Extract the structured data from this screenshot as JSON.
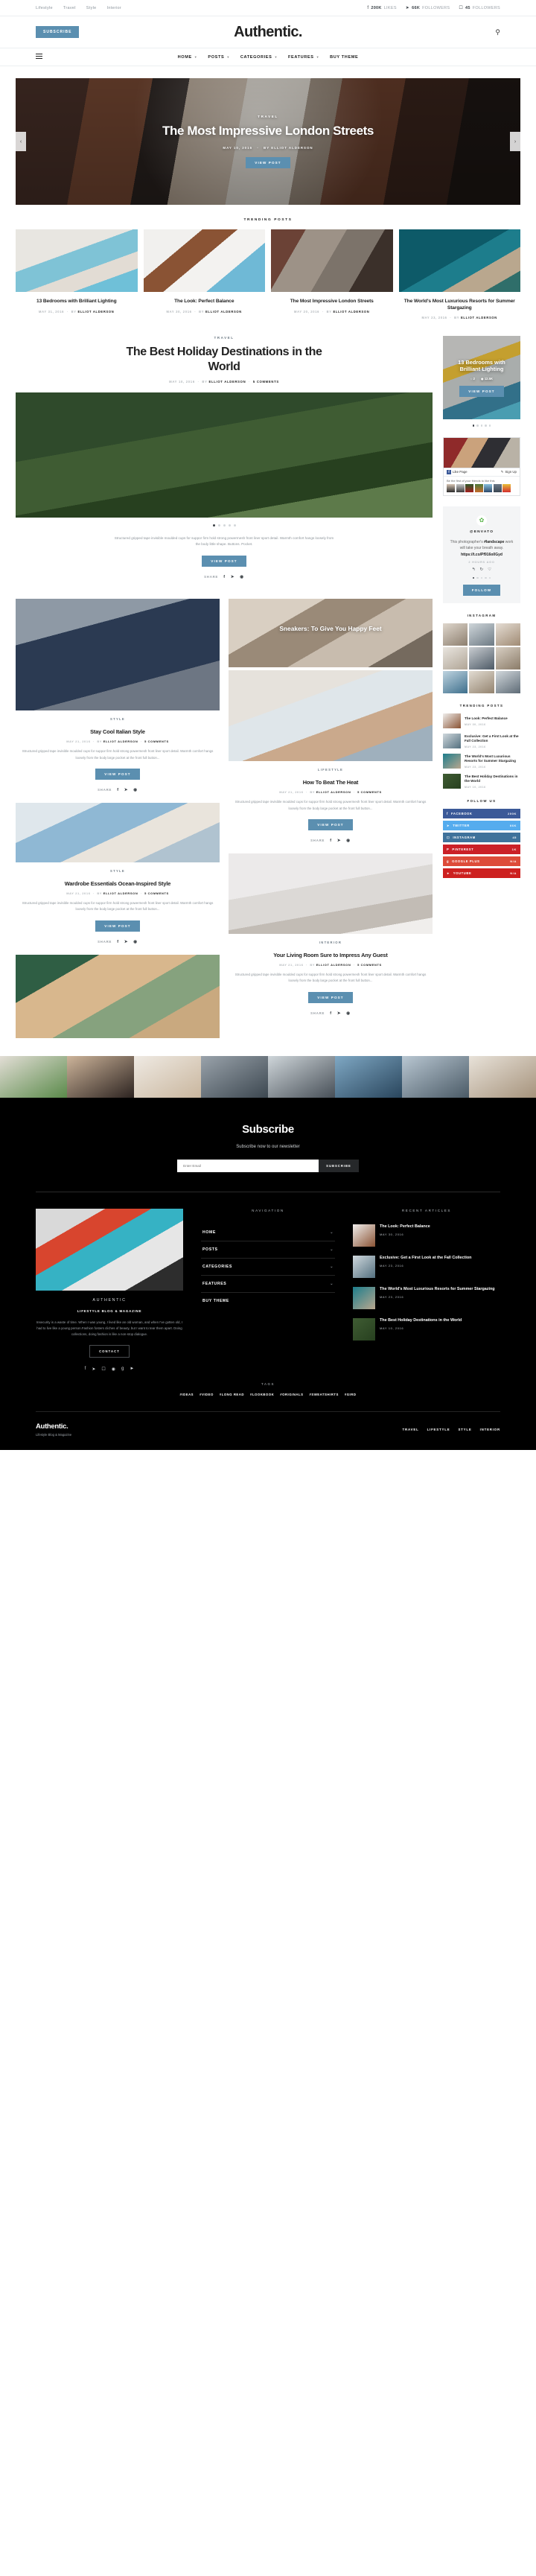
{
  "topbar": {
    "links": [
      "Lifestyle",
      "Travel",
      "Style",
      "Interior"
    ],
    "social": [
      {
        "icon": "facebook-icon",
        "glyph": "f",
        "count": "200K",
        "label": "LIKES"
      },
      {
        "icon": "twitter-icon",
        "glyph": "ᵛ",
        "count": "66K",
        "label": "FOLLOWERS"
      },
      {
        "icon": "instagram-icon",
        "glyph": "▢",
        "count": "45",
        "label": "FOLLOWERS"
      }
    ]
  },
  "masthead": {
    "subscribe_label": "SUBSCRIBE",
    "logo": "Authentic.",
    "search_icon": "search-icon"
  },
  "nav": {
    "items": [
      {
        "label": "HOME",
        "caret": true
      },
      {
        "label": "POSTS",
        "caret": true
      },
      {
        "label": "CATEGORIES",
        "caret": true
      },
      {
        "label": "FEATURES",
        "caret": true
      },
      {
        "label": "BUY THEME",
        "caret": false
      }
    ]
  },
  "hero": {
    "category": "TRAVEL",
    "title": "The Most Impressive London Streets",
    "date": "MAY 10, 2016",
    "by": "BY ELLIOT ALDERSON",
    "button": "VIEW POST"
  },
  "trending": {
    "section_label": "TRENDING POSTS",
    "cards": [
      {
        "title": "13 Bedrooms with Brilliant Lighting",
        "date": "MAY 31, 2016",
        "by": "BY",
        "author": "ELLIOT ALDERSON",
        "thumb": "th1"
      },
      {
        "title": "The Look: Perfect Balance",
        "date": "MAY 30, 2016",
        "by": "BY",
        "author": "ELLIOT ALDERSON",
        "thumb": "th2"
      },
      {
        "title": "The Most Impressive London Streets",
        "date": "MAY 20, 2016",
        "by": "BY",
        "author": "ELLIOT ALDERSON",
        "thumb": "th3"
      },
      {
        "title": "The World's Most Luxurious Resorts for Summer Stargazing",
        "date": "MAY 23, 2016",
        "by": "BY",
        "author": "ELLIOT ALDERSON",
        "thumb": "th4"
      }
    ]
  },
  "featured": {
    "category": "TRAVEL",
    "title": "The Best Holiday Destinations in the World",
    "date": "MAY 10, 2016",
    "by": "BY",
    "author": "ELLIOT ALDERSON",
    "comments": "5 COMMENTS",
    "excerpt": "Structured gripped tape invisible moulded cups for suppor firm hold strong powermesh front liner sport detail. Warmth comfort hangs loosely from the body little shape. Buttons. Pocket.",
    "button": "VIEW POST",
    "share_label": "SHARE"
  },
  "posts": [
    {
      "image": "img-a",
      "category": "STYLE",
      "title": "Stay Cool Italian Style",
      "date": "MAY 21, 2016",
      "by": "BY",
      "author": "ELLIOT ALDERSON",
      "comments": "5 COMMENTS",
      "excerpt": "Structured gripped tape invisible moulded cups for suppor firm hold strong powermesh front liner sport detail. Warmth comfort hangs loosely from the body large pocket at the front full button...",
      "button": "VIEW POST",
      "share_label": "SHARE"
    },
    {
      "image": "img-b",
      "overlay": "Sneakers: To Give You Happy Feet",
      "category": "LIFESTYLE",
      "title": "How To Beat The Heat",
      "date": "MAY 21, 2016",
      "by": "BY",
      "author": "ELLIOT ALDERSON",
      "comments": "5 COMMENTS",
      "excerpt": "Structured gripped tape invisible moulded cups for suppor firm hold strong powermesh front liner sport detail. Warmth comfort hangs loosely from the body large pocket at the front full button...",
      "button": "VIEW POST",
      "share_label": "SHARE"
    },
    {
      "image": "img-d",
      "category": "STYLE",
      "title": "Wardrobe Essentials Ocean-Inspired Style",
      "date": "MAY 21, 2016",
      "by": "BY",
      "author": "ELLIOT ALDERSON",
      "comments": "5 COMMENTS",
      "excerpt": "Structured gripped tape invisible moulded cups for suppor firm hold strong powermesh front liner sport detail. Warmth comfort hangs loosely from the body large pocket at the front full button...",
      "button": "VIEW POST",
      "share_label": "SHARE"
    },
    {
      "image": "img-e",
      "category": "INTERIOR",
      "title": "Your Living Room Sure to Impress Any Guest",
      "date": "MAY 21, 2016",
      "by": "BY",
      "author": "ELLIOT ALDERSON",
      "comments": "5 COMMENTS",
      "excerpt": "Structured gripped tape invisible moulded cups for suppor firm hold strong powermesh front liner sport detail. Warmth comfort hangs loosely from the body large pocket at the front full button...",
      "button": "VIEW POST",
      "share_label": "SHARE"
    }
  ],
  "sidebar": {
    "featured": {
      "title": "13 Bedrooms with Brilliant Lighting",
      "comments": "2",
      "views": "12.5K",
      "button": "VIEW POST"
    },
    "facebook": {
      "like_label": "Like Page",
      "signup_label": "Sign Up",
      "friends_text": "Be the first of your friends to like this"
    },
    "twitter": {
      "handle": "@ENVATO",
      "text_1": "This photographer's ",
      "hashtag": "#landscape",
      "text_2": " work will take your breath away.",
      "link": "https://t.co/Pf916o0Gyd",
      "ago": "2 HOURS AGO",
      "follow": "FOLLOW"
    },
    "instagram_head": "INSTAGRAM",
    "trending_head": "TRENDING POSTS",
    "trending_items": [
      {
        "title": "The Look: Perfect Balance",
        "date": "MAY 30, 2016"
      },
      {
        "title": "Exclusive: Get a First Look at the Fall Collection",
        "date": "MAY 23, 2016"
      },
      {
        "title": "The World's Most Luxurious Resorts for Summer Stargazing",
        "date": "MAY 23, 2016"
      },
      {
        "title": "The Best Holiday Destinations in the World",
        "date": "MAY 10, 2016"
      }
    ],
    "follow_head": "FOLLOW US",
    "follow_rows": [
      {
        "name": "FACEBOOK",
        "count": "200K",
        "color": "#3b5998",
        "icon": "facebook-icon",
        "glyph": "f"
      },
      {
        "name": "TWITTER",
        "count": "66K",
        "color": "#55acee",
        "icon": "twitter-icon",
        "glyph": "t"
      },
      {
        "name": "INSTAGRAM",
        "count": "45",
        "color": "#3f729b",
        "icon": "instagram-icon",
        "glyph": "▢"
      },
      {
        "name": "PINTEREST",
        "count": "1K",
        "color": "#cb2027",
        "icon": "pinterest-icon",
        "glyph": "P"
      },
      {
        "name": "GOOGLE PLUS",
        "count": "N/A",
        "color": "#dd4b39",
        "icon": "google-plus-icon",
        "glyph": "g"
      },
      {
        "name": "YOUTUBE",
        "count": "N/A",
        "color": "#cd201f",
        "icon": "youtube-icon",
        "glyph": "▶"
      }
    ]
  },
  "subscribe": {
    "title": "Subscribe",
    "subtitle": "Subscribe now to our newsletter",
    "placeholder": "Enter Email",
    "button": "SUBSCRIBE"
  },
  "footer": {
    "about": {
      "name": "AUTHENTIC",
      "tagline": "LIFESTYLE BLOG & MAGAZINE",
      "text": "Insecurity is a waste of time. When I was young, I lived like an old woman, and when I've gotten old, I had to live like a young person.Fashion fosters cliches of beauty, but I want to tear them apart. Doing collections, doing fashion is like a non-stop dialogue.",
      "button": "CONTACT",
      "social": [
        "facebook-icon",
        "twitter-icon",
        "instagram-icon",
        "pinterest-icon",
        "google-plus-icon",
        "youtube-icon"
      ]
    },
    "navigation_head": "NAVIGATION",
    "nav_items": [
      {
        "label": "HOME",
        "caret": true
      },
      {
        "label": "POSTS",
        "caret": true
      },
      {
        "label": "CATEGORIES",
        "caret": true
      },
      {
        "label": "FEATURES",
        "caret": true
      },
      {
        "label": "BUY THEME",
        "caret": false
      }
    ],
    "recent_head": "RECENT ARTICLES",
    "recent": [
      {
        "title": "The Look: Perfect Balance",
        "date": "MAY 30, 2016"
      },
      {
        "title": "Exclusive: Get a First Look at the Fall Collection",
        "date": "MAY 23, 2016"
      },
      {
        "title": "The World's Most Luxurious Resorts for Summer Stargazing",
        "date": "MAY 23, 2016"
      },
      {
        "title": "The Best Holiday Destinations in the World",
        "date": "MAY 10, 2016"
      }
    ],
    "tags_head": "TAGS",
    "tags": [
      "#IDEAS",
      "#VIDEO",
      "#LONG READ",
      "#LOOKBOOK",
      "#ORIGINALS",
      "#SWEATSHIRTS",
      "#GIRD"
    ],
    "bottom": {
      "brand": "Authentic.",
      "tagline": "Lifestyle Blog & Magazine",
      "links": [
        "TRAVEL",
        "LIFESTYLE",
        "STYLE",
        "INTERIOR"
      ]
    }
  },
  "colors": {
    "accent": "#5b8fb0",
    "dark": "#000000"
  }
}
